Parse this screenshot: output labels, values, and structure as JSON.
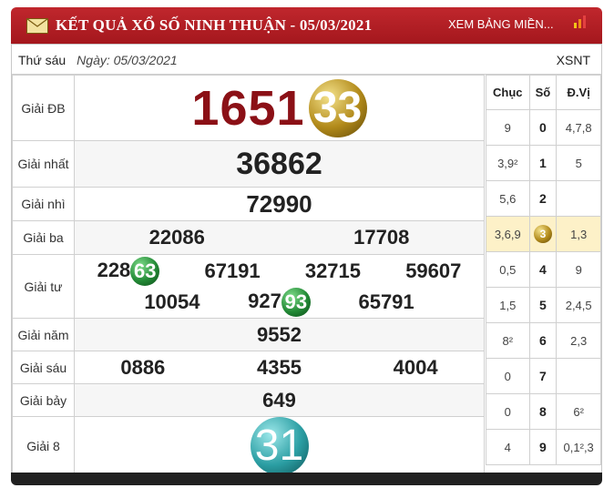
{
  "header": {
    "title": "KẾT QUẢ XỔ SỐ NINH THUẬN - 05/03/2021",
    "link": "XEM BẢNG MIỀN..."
  },
  "date_row": {
    "day": "Thứ sáu",
    "date": "Ngày: 05/03/2021",
    "code": "XSNT"
  },
  "prizes": {
    "db": {
      "label": "Giải ĐB",
      "head": "1651",
      "tail": "33"
    },
    "nhat": {
      "label": "Giải nhất",
      "values": [
        "36862"
      ]
    },
    "nhi": {
      "label": "Giải nhì",
      "values": [
        "72990"
      ]
    },
    "ba": {
      "label": "Giải ba",
      "values": [
        "22086",
        "17708"
      ]
    },
    "tu": {
      "label": "Giải tư",
      "row1": [
        {
          "head": "228",
          "tail": "63"
        },
        {
          "head": "67191",
          "tail": ""
        },
        {
          "head": "32715",
          "tail": ""
        },
        {
          "head": "59607",
          "tail": ""
        }
      ],
      "row2": [
        {
          "head": "10054",
          "tail": ""
        },
        {
          "head": "927",
          "tail": "93"
        },
        {
          "head": "65791",
          "tail": ""
        }
      ]
    },
    "nam": {
      "label": "Giải năm",
      "values": [
        "9552"
      ]
    },
    "sau": {
      "label": "Giải sáu",
      "values": [
        "0886",
        "4355",
        "4004"
      ]
    },
    "bay": {
      "label": "Giải bảy",
      "values": [
        "649"
      ]
    },
    "tam": {
      "label": "Giải 8",
      "value": "31"
    }
  },
  "loto": {
    "headers": [
      "Chục",
      "Số",
      "Đ.Vị"
    ],
    "rows": [
      {
        "chuc": "9",
        "so": "0",
        "dvi": "4,7,8"
      },
      {
        "chuc": "3,9²",
        "so": "1",
        "dvi": "5"
      },
      {
        "chuc": "5,6",
        "so": "2",
        "dvi": ""
      },
      {
        "chuc": "3,6,9",
        "so": "3",
        "dvi": "1,3"
      },
      {
        "chuc": "0,5",
        "so": "4",
        "dvi": "9"
      },
      {
        "chuc": "1,5",
        "so": "5",
        "dvi": "2,4,5"
      },
      {
        "chuc": "8²",
        "so": "6",
        "dvi": "2,3"
      },
      {
        "chuc": "0",
        "so": "7",
        "dvi": ""
      },
      {
        "chuc": "0",
        "so": "8",
        "dvi": "6²"
      },
      {
        "chuc": "4",
        "so": "9",
        "dvi": "0,1²,3"
      }
    ]
  },
  "colors": {
    "header": "#b01e24",
    "db_number": "#8b1016",
    "highlight_row": "#fdf1c8"
  }
}
